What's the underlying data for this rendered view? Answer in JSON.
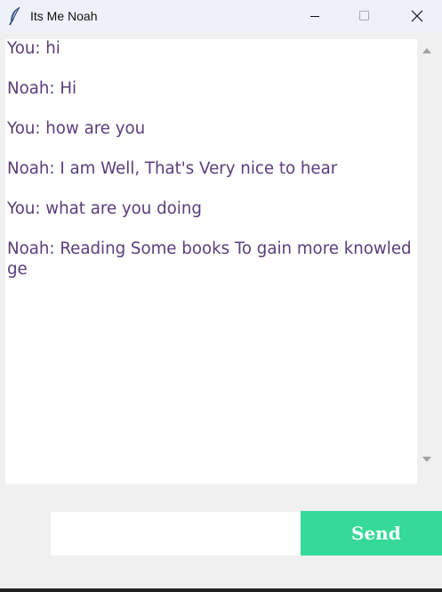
{
  "window": {
    "title": "Its Me Noah",
    "icon": "feather-icon",
    "controls": [
      "minimize-icon",
      "maximize-icon",
      "close-icon"
    ]
  },
  "chat": {
    "messages": [
      "You: hi",
      "Noah: Hi",
      "You: how are you",
      "Noah: I am Well, That's Very nice to hear",
      "You: what are you doing",
      "Noah: Reading Some books To gain more knowledge"
    ],
    "text_color": "#5a3d7c"
  },
  "input": {
    "value": "",
    "placeholder": ""
  },
  "send_button": {
    "label": "Send",
    "color": "#35d998"
  }
}
